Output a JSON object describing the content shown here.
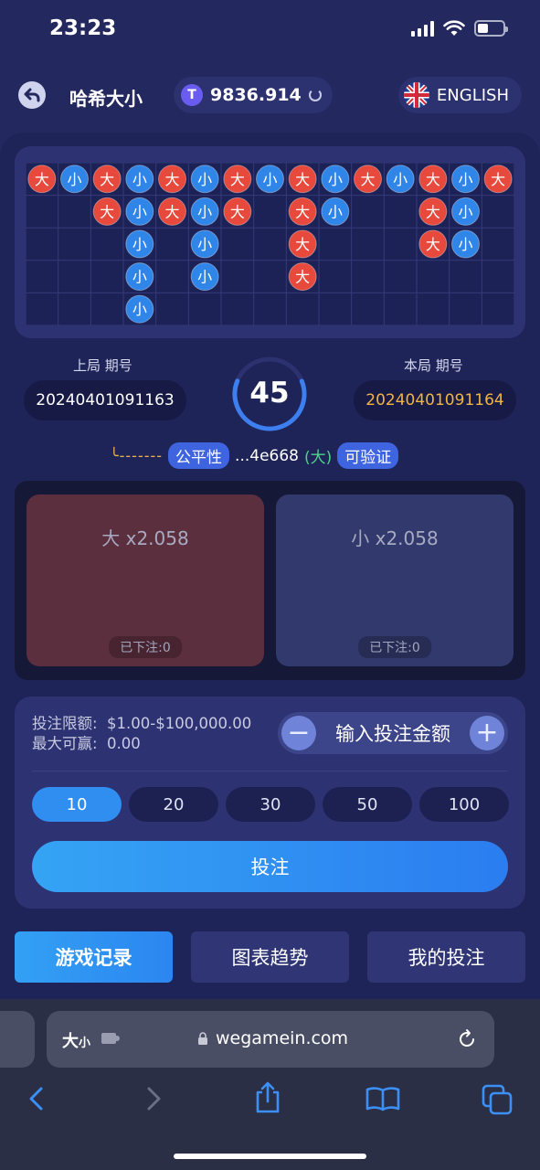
{
  "status_bar": {
    "time": "23:23"
  },
  "header": {
    "title": "哈希大小",
    "balance": "9836.914",
    "language": "ENGLISH"
  },
  "road": {
    "label_big": "大",
    "label_small": "小",
    "columns": [
      [
        "大"
      ],
      [
        "小"
      ],
      [
        "大",
        "大"
      ],
      [
        "小",
        "小",
        "小",
        "小",
        "小"
      ],
      [
        "大",
        "大"
      ],
      [
        "小",
        "小",
        "小",
        "小"
      ],
      [
        "大",
        "大"
      ],
      [
        "小"
      ],
      [
        "大",
        "大",
        "大",
        "大"
      ],
      [
        "小",
        "小"
      ],
      [
        "大"
      ],
      [
        "小"
      ],
      [
        "大",
        "大",
        "大"
      ],
      [
        "小",
        "小",
        "小"
      ],
      [
        "大"
      ]
    ]
  },
  "periods": {
    "last_label": "上局 期号",
    "last_value": "20240401091163",
    "current_label": "本局 期号",
    "current_value": "20240401091164"
  },
  "timer": {
    "value": "45",
    "progress": 0.62
  },
  "fairness": {
    "dashes": "╰-------",
    "fair_label": "公平性",
    "hash": "...4e668",
    "result": "(大)",
    "verify_label": "可验证"
  },
  "bets": {
    "big": {
      "label": "大 x2.058",
      "placed": "已下注:0"
    },
    "small": {
      "label": "小 x2.058",
      "placed": "已下注:0"
    }
  },
  "controls": {
    "limit_line": "投注限额:  $1.00-$100,000.00",
    "max_win_line": "最大可赢:  0.00",
    "minus": "−",
    "plus": "+",
    "amount_placeholder": "输入投注金额",
    "chips": [
      "10",
      "20",
      "30",
      "50",
      "100"
    ],
    "selected_chip": "10",
    "submit_label": "投注"
  },
  "tabs": {
    "history": "游戏记录",
    "trend": "图表趋势",
    "my_bets": "我的投注"
  },
  "browser": {
    "site_name_big": "大",
    "site_name_small": "小",
    "url": "wegamein.com"
  },
  "colors": {
    "big_ball": "#e74a3c",
    "small_ball": "#2f86e8",
    "accent_blue": "#2f8ef0",
    "current_period": "#f2b443",
    "result_green": "#4fd08a"
  }
}
